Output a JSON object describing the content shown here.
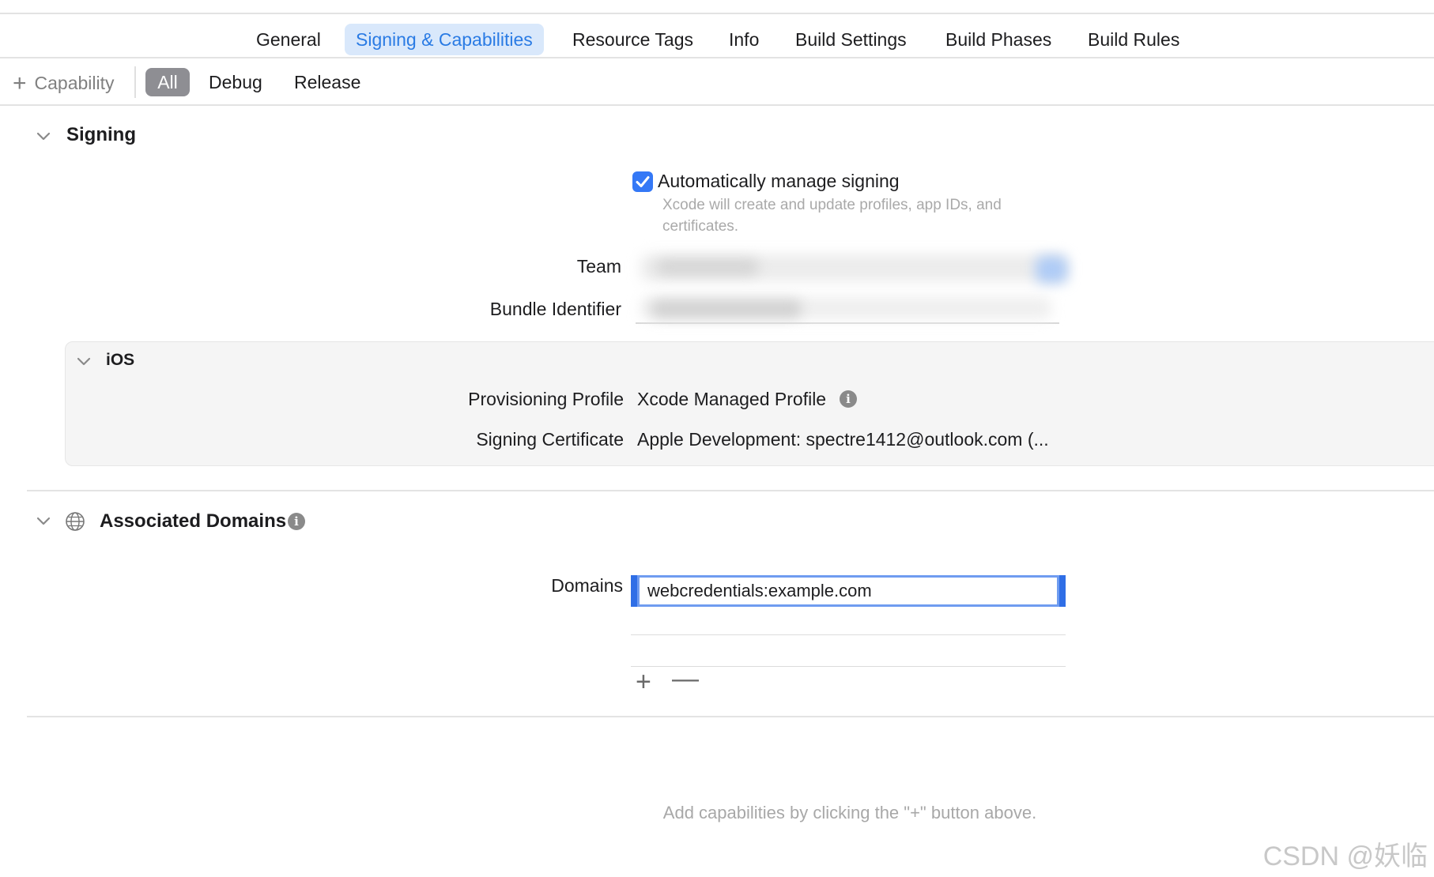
{
  "tabs": [
    "General",
    "Signing & Capabilities",
    "Resource Tags",
    "Info",
    "Build Settings",
    "Build Phases",
    "Build Rules"
  ],
  "filter_bar": {
    "add_capability": "Capability",
    "segments": [
      "All",
      "Debug",
      "Release"
    ]
  },
  "signing": {
    "title": "Signing",
    "auto_manage_label": "Automatically manage signing",
    "auto_manage_checked": true,
    "auto_manage_hint_line1": "Xcode will create and update profiles, app IDs, and",
    "auto_manage_hint_line2": "certificates.",
    "team_label": "Team",
    "bundle_id_label": "Bundle Identifier",
    "ios": {
      "title": "iOS",
      "provisioning_label": "Provisioning Profile",
      "provisioning_value": "Xcode Managed Profile",
      "certificate_label": "Signing Certificate",
      "certificate_value": "Apple Development: spectre1412@outlook.com (..."
    }
  },
  "associated_domains": {
    "title": "Associated Domains",
    "domains_label": "Domains",
    "domain_value": "webcredentials:example.com"
  },
  "footer_hint": "Add capabilities by clicking the \"+\" button above.",
  "watermark": "CSDN @妖临",
  "colors": {
    "accent": "#2a7be4",
    "tab_active_bg": "#d9e8fb",
    "checkbox": "#3478f6",
    "pill_bg": "#8e8e93"
  },
  "icons": [
    "plus-icon",
    "chevron-down-icon",
    "checkmark-icon",
    "info-icon",
    "globe-icon",
    "minus-icon"
  ]
}
